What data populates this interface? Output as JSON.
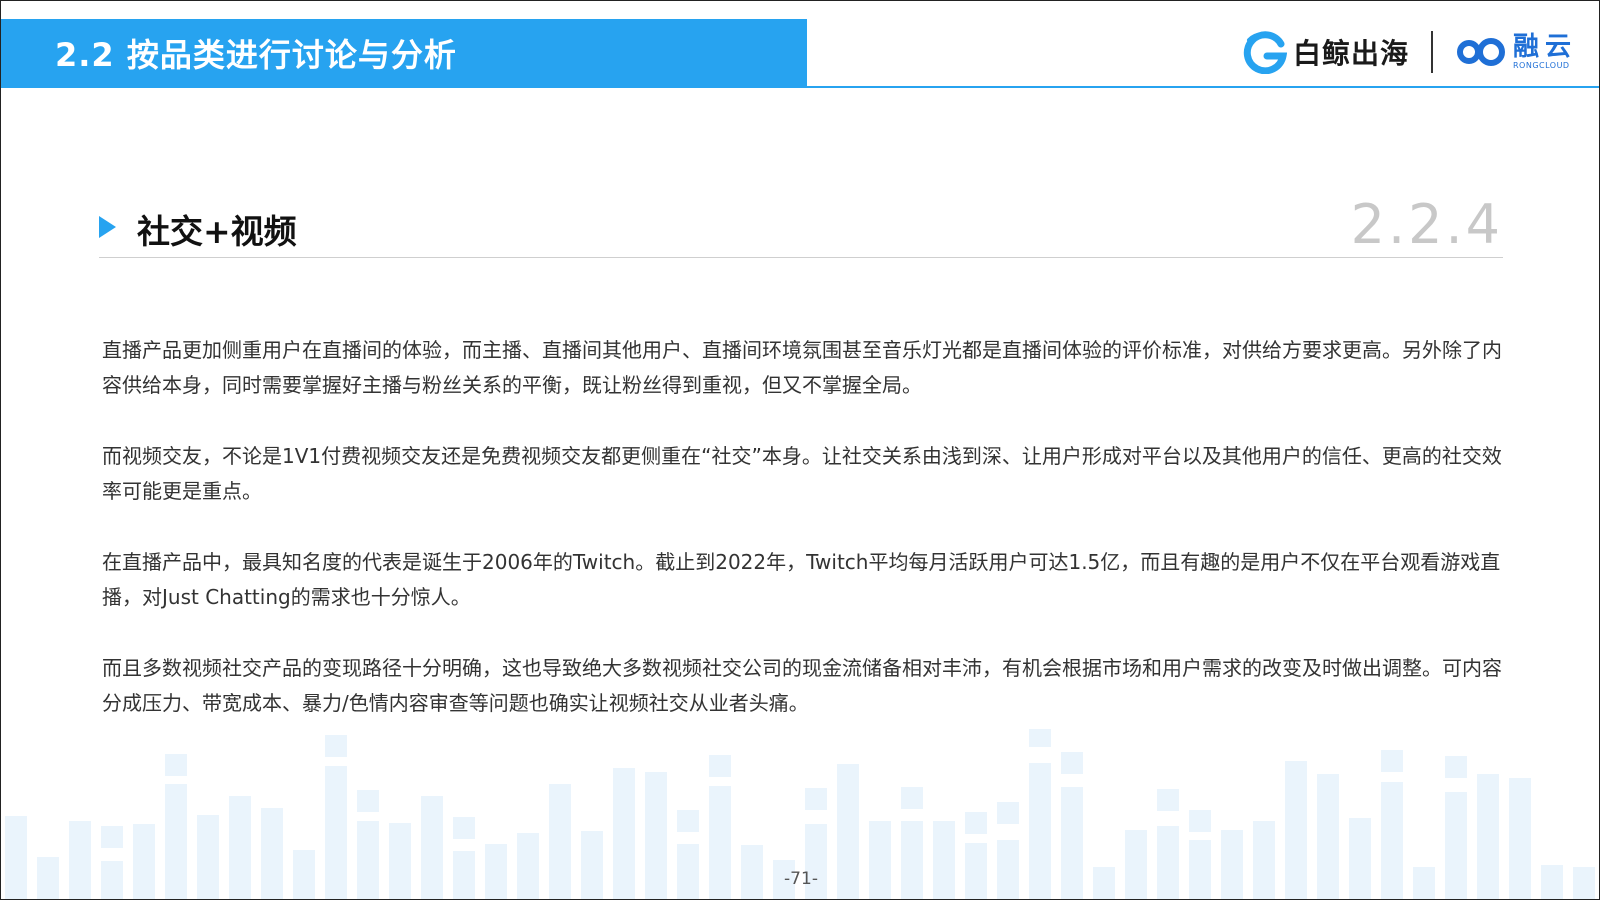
{
  "header": {
    "title": "2.2 按品类进行讨论与分析",
    "logo_baijing": "白鲸出海",
    "logo_rong_cn": "融云",
    "logo_rong_en": "RONGCLOUD"
  },
  "section": {
    "heading": "社交+视频",
    "number": "2.2.4"
  },
  "paragraphs": [
    "直播产品更加侧重用户在直播间的体验，而主播、直播间其他用户、直播间环境氛围甚至音乐灯光都是直播间体验的评价标准，对供给方要求更高。另外除了内容供给本身，同时需要掌握好主播与粉丝关系的平衡，既让粉丝得到重视，但又不掌握全局。",
    "而视频交友，不论是1V1付费视频交友还是免费视频交友都更侧重在“社交”本身。让社交关系由浅到深、让用户形成对平台以及其他用户的信任、更高的社交效率可能更是重点。",
    "在直播产品中，最具知名度的代表是诞生于2006年的Twitch。截止到2022年，Twitch平均每月活跃用户可达1.5亿，而且有趣的是用户不仅在平台观看游戏直播，对Just Chatting的需求也十分惊人。",
    "而且多数视频社交产品的变现路径十分明确，这也导致绝大多数视频社交公司的现金流储备相对丰沛，有机会根据市场和用户需求的改变及时做出调整。可内容分成压力、带宽成本、暴力/色情内容审查等问题也确实让视频社交从业者头痛。"
  ],
  "footer": {
    "page_number": "-71-"
  },
  "colors": {
    "accent": "#27A3F0",
    "deco_bar": "#EAF4FC",
    "section_number": "#C8C8C8"
  }
}
